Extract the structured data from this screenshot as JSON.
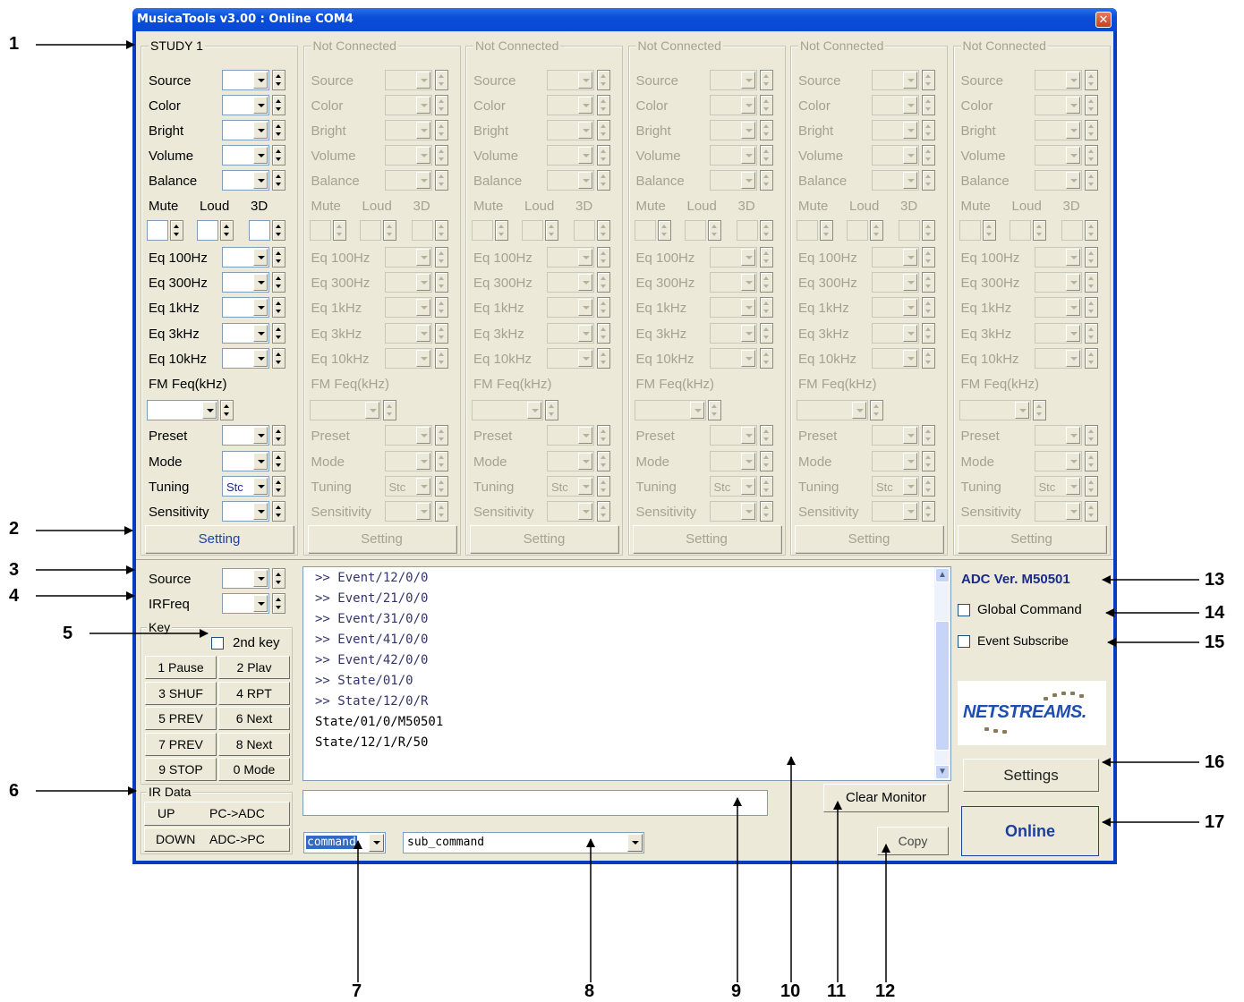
{
  "window": {
    "title": "MusicaTools v3.00 : Online COM4",
    "close_glyph": "✕"
  },
  "zones": [
    {
      "title": "STUDY 1",
      "enabled": true
    },
    {
      "title": "Not Connected",
      "enabled": false
    },
    {
      "title": "Not Connected",
      "enabled": false
    },
    {
      "title": "Not Connected",
      "enabled": false
    },
    {
      "title": "Not Connected",
      "enabled": false
    },
    {
      "title": "Not Connected",
      "enabled": false
    }
  ],
  "zone_labels": {
    "source": "Source",
    "color": "Color",
    "bright": "Bright",
    "volume": "Volume",
    "balance": "Balance",
    "mute": "Mute",
    "loud": "Loud",
    "three_d": "3D",
    "eq100": "Eq 100Hz",
    "eq300": "Eq 300Hz",
    "eq1k": "Eq  1kHz",
    "eq3k": "Eq  3kHz",
    "eq10k": "Eq 10kHz",
    "fm": "FM Feq(kHz)",
    "preset": "Preset",
    "mode": "Mode",
    "tuning": "Tuning",
    "sensitivity": "Sensitivity",
    "tuning_value": "Stc",
    "setting": "Setting"
  },
  "lower_left": {
    "source_label": "Source",
    "irfreq_label": "IRFreq",
    "key_group": "Key",
    "second_key": "2nd key",
    "keys": [
      "1 Pause",
      "2 Plav",
      "3 SHUF",
      "4 RPT",
      "5 PREV",
      "6 Next",
      "7 PREV",
      "8 Next",
      "9 STOP",
      "0 Mode"
    ],
    "ir_group": "IR Data",
    "ir_up": "UP",
    "ir_pc_adc": "PC->ADC",
    "ir_down": "DOWN",
    "ir_adc_pc": "ADC->PC"
  },
  "monitor": {
    "lines": [
      {
        "text": ">> Event/12/0/0",
        "kind": "out"
      },
      {
        "text": ">> Event/21/0/0",
        "kind": "out"
      },
      {
        "text": ">> Event/31/0/0",
        "kind": "out"
      },
      {
        "text": ">> Event/41/0/0",
        "kind": "out"
      },
      {
        "text": ">> Event/42/0/0",
        "kind": "out"
      },
      {
        "text": ">> State/01/0",
        "kind": "out"
      },
      {
        "text": ">> State/12/0/R",
        "kind": "out"
      },
      {
        "text": "State/01/0/M50501",
        "kind": "in"
      },
      {
        "text": "State/12/1/R/50",
        "kind": "in"
      }
    ],
    "command_input_value": "",
    "command_select": "command",
    "sub_command_select": "sub_command",
    "clear_button": "Clear Monitor",
    "copy_button": "Copy"
  },
  "right_panel": {
    "adc_version": "ADC Ver. M50501",
    "global_command": "Global Command",
    "event_subscribe": "Event Subscribe",
    "logo_text": "NETSTREAMS.",
    "settings_button": "Settings",
    "online_button": "Online"
  },
  "callouts": [
    "1",
    "2",
    "3",
    "4",
    "5",
    "6",
    "7",
    "8",
    "9",
    "10",
    "11",
    "12",
    "13",
    "14",
    "15",
    "16",
    "17"
  ],
  "colors": {
    "title_bar": "#0a4ed8",
    "dialog_face": "#ece9d8",
    "link_blue": "#1f3fa8",
    "version_navy": "#1a2a8a"
  }
}
